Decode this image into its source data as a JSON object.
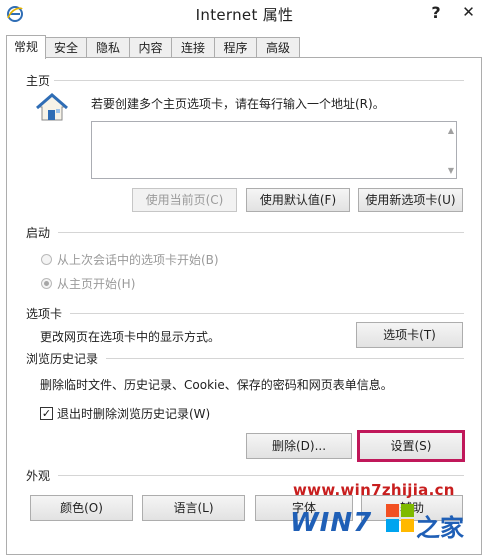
{
  "window": {
    "title": "Internet 属性",
    "help_label": "?",
    "close_label": "✕"
  },
  "tabs": [
    {
      "label": "常规",
      "active": true
    },
    {
      "label": "安全"
    },
    {
      "label": "隐私"
    },
    {
      "label": "内容"
    },
    {
      "label": "连接"
    },
    {
      "label": "程序"
    },
    {
      "label": "高级"
    }
  ],
  "homepage": {
    "group_label": "主页",
    "instruction": "若要创建多个主页选项卡，请在每行输入一个地址(R)。",
    "address_value": "",
    "buttons": {
      "use_current": "使用当前页(C)",
      "use_default": "使用默认值(F)",
      "use_new_tab": "使用新选项卡(U)"
    }
  },
  "startup": {
    "group_label": "启动",
    "option_last_session": "从上次会话中的选项卡开始(B)",
    "option_homepage": "从主页开始(H)"
  },
  "tabs_section": {
    "group_label": "选项卡",
    "description": "更改网页在选项卡中的显示方式。",
    "button": "选项卡(T)"
  },
  "history": {
    "group_label": "浏览历史记录",
    "description": "删除临时文件、历史记录、Cookie、保存的密码和网页表单信息。",
    "checkbox_label": "退出时删除浏览历史记录(W)",
    "checkbox_mark": "✓",
    "delete_button": "删除(D)...",
    "settings_button": "设置(S)"
  },
  "appearance": {
    "group_label": "外观",
    "colors_button": "颜色(O)",
    "languages_button": "语言(L)",
    "fonts_button": "字体",
    "accessibility_button": "辅助"
  },
  "watermark": {
    "url": "www.win7zhijia.cn",
    "brand": "WIN7",
    "suffix": "之家"
  },
  "colors": {
    "highlight_border": "#c0185a",
    "watermark_red": "#c81e1e",
    "home_icon_blue": "#2f6db5"
  }
}
